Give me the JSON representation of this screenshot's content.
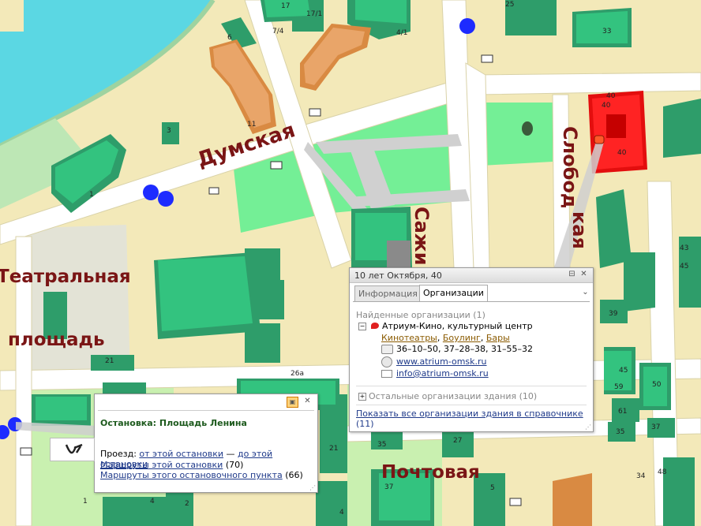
{
  "map": {
    "streets": {
      "dumskaya": "Думская",
      "teatralnaya": "Театральная",
      "ploshchad": "площадь",
      "sazhin": "Сажи",
      "slobod": "Слобод",
      "kaya": "кая",
      "pochtovaya": "Почтовая"
    },
    "house_numbers": [
      "17",
      "17/1",
      "7/4",
      "4/1",
      "25",
      "33",
      "40",
      "40",
      "40",
      "6",
      "3",
      "11",
      "1",
      "21",
      "26а",
      "45",
      "59",
      "50",
      "61",
      "35",
      "37",
      "43",
      "45",
      "39",
      "27",
      "35",
      "21",
      "4",
      "4",
      "5",
      "34",
      "48",
      "1",
      "2",
      "37"
    ],
    "colors": {
      "building": "#2e9d6a",
      "building_top": "#33c37f",
      "highlight": "#ff1d1d",
      "park": "#74ef96",
      "river": "#5bd7e3",
      "road": "#ffffff",
      "ground": "#f3e9b9"
    }
  },
  "org_popup": {
    "title": "10 лет Октября, 40",
    "tab_info": "Информация",
    "tab_orgs": "Организации",
    "found_label": "Найденные организации (1)",
    "org_name": "Атриум-Кино, культурный центр",
    "categories": [
      "Кинотеатры",
      "Боулинг",
      "Бары"
    ],
    "phones": "36–10–50, 37–28–38, 31–55–32",
    "website": "www.atrium-omsk.ru",
    "email": "info@atrium-omsk.ru",
    "other_orgs": "Остальные организации здания (10)",
    "show_all": "Показать все организации здания в справочнике",
    "show_all_count": "(11)"
  },
  "stop_popup": {
    "title": "Остановка: Площадь Ленина",
    "route_prefix": "Проезд:",
    "from_stop": "от этой остановки",
    "dash": "—",
    "to_stop": "до этой остановки",
    "routes_link": "Маршруты этой остановки",
    "routes_count": "(70)",
    "point_routes_link": "Маршруты этого остановочного пункта",
    "point_routes_count": "(66)"
  }
}
